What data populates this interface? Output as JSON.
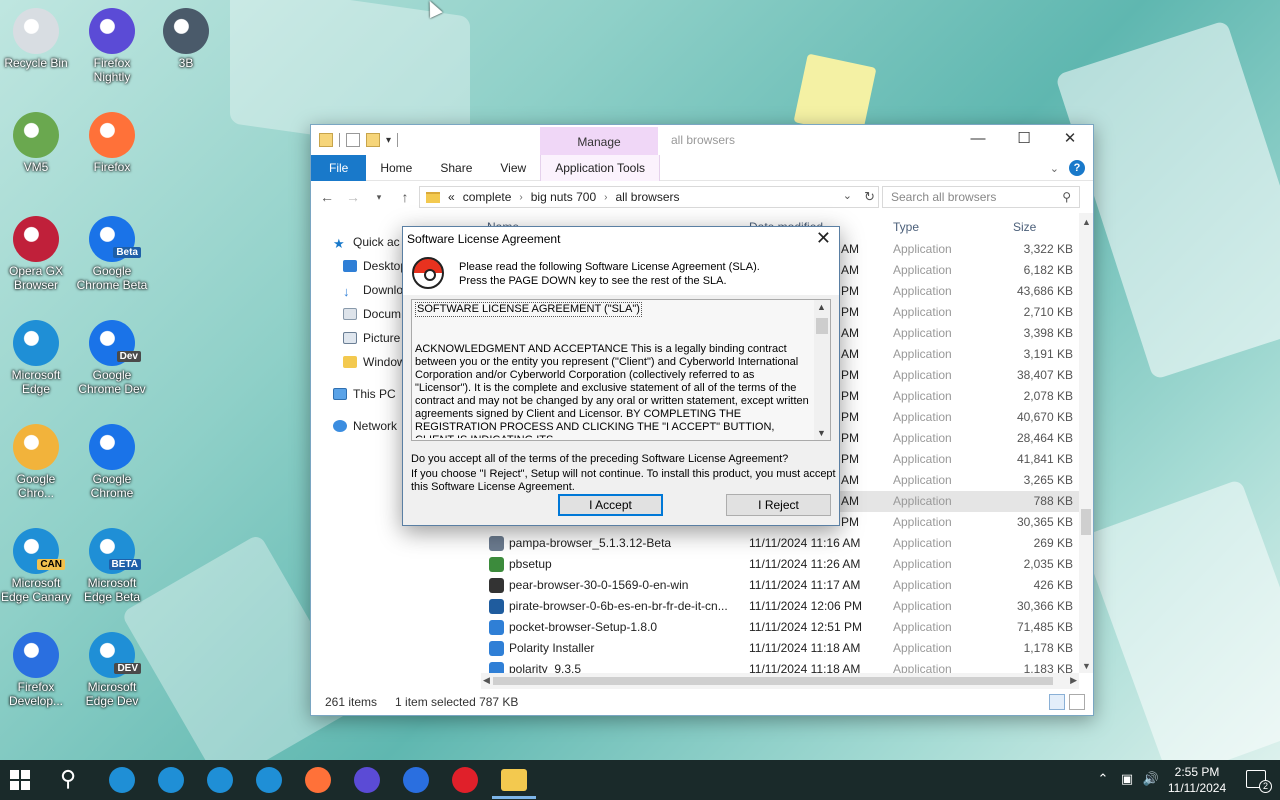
{
  "desktop": {
    "icons": [
      {
        "label": "Recycle Bin",
        "icon": "recycle-bin-icon",
        "color": "#d8dde2"
      },
      {
        "label": "Firefox Nightly",
        "icon": "firefox-nightly-icon",
        "color": "#5b4bd6"
      },
      {
        "label": "3B",
        "icon": "3b-icon",
        "color": "#4a5a6a"
      },
      {
        "label": "VM5",
        "icon": "vm5-icon",
        "color": "#6aa84f"
      },
      {
        "label": "Firefox",
        "icon": "firefox-icon",
        "color": "#ff7139"
      },
      {
        "label": "Opera GX Browser",
        "icon": "opera-gx-icon",
        "color": "#c0203a"
      },
      {
        "label": "Google Chrome Beta",
        "icon": "chrome-beta-icon",
        "color": "#1a73e8",
        "badge": "Beta"
      },
      {
        "label": "Microsoft Edge",
        "icon": "edge-icon",
        "color": "#1f8fd6"
      },
      {
        "label": "Google Chrome Dev",
        "icon": "chrome-dev-icon",
        "color": "#1a73e8",
        "badge": "Dev"
      },
      {
        "label": "Google Chro...",
        "icon": "chrome-canary-icon",
        "color": "#f2b33b"
      },
      {
        "label": "Google Chrome",
        "icon": "chrome-icon",
        "color": "#1a73e8"
      },
      {
        "label": "Microsoft Edge Canary",
        "icon": "edge-canary-icon",
        "color": "#1f8fd6",
        "badge": "CAN"
      },
      {
        "label": "Microsoft Edge Beta",
        "icon": "edge-beta-icon",
        "color": "#1f8fd6",
        "badge": "BETA"
      },
      {
        "label": "Firefox Develop...",
        "icon": "firefox-dev-icon",
        "color": "#2a6fe0"
      },
      {
        "label": "Microsoft Edge Dev",
        "icon": "edge-dev-icon",
        "color": "#1f8fd6",
        "badge": "DEV"
      }
    ]
  },
  "explorer": {
    "window_title": "all browsers",
    "manage_tab": "Manage",
    "ribbon_tabs": [
      "File",
      "Home",
      "Share",
      "View",
      "Application Tools"
    ],
    "breadcrumb": [
      "complete",
      "big nuts 700",
      "all browsers"
    ],
    "breadcrumb_prefix": "«",
    "search_placeholder": "Search all browsers",
    "nav_items": [
      {
        "label": "Quick ac",
        "icon": "star-icon"
      },
      {
        "label": "Desktop",
        "icon": "desktop-icon"
      },
      {
        "label": "Downlo",
        "icon": "download-icon"
      },
      {
        "label": "Docum",
        "icon": "document-icon"
      },
      {
        "label": "Picture",
        "icon": "pictures-icon"
      },
      {
        "label": "Window",
        "icon": "folder-icon"
      },
      {
        "label": "This PC",
        "icon": "this-pc-icon"
      },
      {
        "label": "Network",
        "icon": "network-icon"
      }
    ],
    "columns": {
      "name": "Name",
      "date": "Date modified",
      "type": "Type",
      "size": "Size"
    },
    "rows": [
      {
        "name": "",
        "date": "AM",
        "type": "Application",
        "size": "3,322 KB"
      },
      {
        "name": "",
        "date": "AM",
        "type": "Application",
        "size": "6,182 KB"
      },
      {
        "name": "",
        "date": "PM",
        "type": "Application",
        "size": "43,686 KB"
      },
      {
        "name": "",
        "date": "PM",
        "type": "Application",
        "size": "2,710 KB"
      },
      {
        "name": "",
        "date": "AM",
        "type": "Application",
        "size": "3,398 KB"
      },
      {
        "name": "",
        "date": "AM",
        "type": "Application",
        "size": "3,191 KB"
      },
      {
        "name": "",
        "date": "PM",
        "type": "Application",
        "size": "38,407 KB"
      },
      {
        "name": "",
        "date": "PM",
        "type": "Application",
        "size": "2,078 KB"
      },
      {
        "name": "",
        "date": "PM",
        "type": "Application",
        "size": "40,670 KB"
      },
      {
        "name": "",
        "date": "PM",
        "type": "Application",
        "size": "28,464 KB"
      },
      {
        "name": "",
        "date": "PM",
        "type": "Application",
        "size": "41,841 KB"
      },
      {
        "name": "",
        "date": "AM",
        "type": "Application",
        "size": "3,265 KB"
      },
      {
        "name": "",
        "date": "AM",
        "type": "Application",
        "size": "788 KB",
        "selected": true
      },
      {
        "name": "",
        "date": "PM",
        "type": "Application",
        "size": "30,365 KB"
      },
      {
        "name": "pampa-browser_5.1.3.12-Beta",
        "date": "11/11/2024 11:16 AM",
        "type": "Application",
        "size": "269 KB"
      },
      {
        "name": "pbsetup",
        "date": "11/11/2024 11:26 AM",
        "type": "Application",
        "size": "2,035 KB"
      },
      {
        "name": "pear-browser-30-0-1569-0-en-win",
        "date": "11/11/2024 11:17 AM",
        "type": "Application",
        "size": "426 KB"
      },
      {
        "name": "pirate-browser-0-6b-es-en-br-fr-de-it-cn...",
        "date": "11/11/2024 12:06 PM",
        "type": "Application",
        "size": "30,366 KB"
      },
      {
        "name": "pocket-browser-Setup-1.8.0",
        "date": "11/11/2024 12:51 PM",
        "type": "Application",
        "size": "71,485 KB"
      },
      {
        "name": "Polarity Installer",
        "date": "11/11/2024 11:18 AM",
        "type": "Application",
        "size": "1,178 KB"
      },
      {
        "name": "polarity_9.3.5",
        "date": "11/11/2024 11:18 AM",
        "type": "Application",
        "size": "1,183 KB"
      }
    ],
    "status": {
      "items": "261 items",
      "selected": "1 item selected  787 KB"
    }
  },
  "dialog": {
    "title": "Software License Agreement",
    "header_line1": "Please read the following Software License Agreement (SLA).",
    "header_line2": "Press the PAGE DOWN key to see the rest of the SLA.",
    "sla_heading": "SOFTWARE LICENSE AGREEMENT (\"SLA\")",
    "sla_body": "ACKNOWLEDGMENT AND ACCEPTANCE  This is a legally binding contract between you or the entity you represent (\"Client\") and Cyberworld International Corporation and/or Cyberworld Corporation (collectively referred to as \"Licensor\"). It is the complete and exclusive statement of all of the terms of the contract and may not be changed by any oral or written statement, except written agreements signed by Client and Licensor. BY COMPLETING THE REGISTRATION PROCESS AND CLICKING THE \"I ACCEPT\" BUTTION, CLIENT IS INDICATING ITS",
    "question": "Do you accept all of the terms of the preceding Software License Agreement?",
    "note": "If you choose \"I Reject\", Setup will not continue.  To install this product, you must accept this Software License Agreement.",
    "accept_label": "I Accept",
    "reject_label": "I Reject"
  },
  "taskbar": {
    "apps": [
      {
        "name": "edge-taskbar-icon",
        "color": "#1f8fd6"
      },
      {
        "name": "edge-beta-taskbar-icon",
        "color": "#1f8fd6"
      },
      {
        "name": "edge-canary-taskbar-icon",
        "color": "#1f8fd6"
      },
      {
        "name": "edge-dev-taskbar-icon",
        "color": "#1f8fd6"
      },
      {
        "name": "firefox-taskbar-icon",
        "color": "#ff7139"
      },
      {
        "name": "firefox-nightly-taskbar-icon",
        "color": "#5b4bd6"
      },
      {
        "name": "firefox-dev-taskbar-icon",
        "color": "#2a6fe0"
      },
      {
        "name": "opera-taskbar-icon",
        "color": "#e0202a"
      },
      {
        "name": "file-explorer-taskbar-icon",
        "color": "#f3c94f"
      }
    ],
    "time": "2:55 PM",
    "date": "11/11/2024",
    "notification_count": "2"
  }
}
